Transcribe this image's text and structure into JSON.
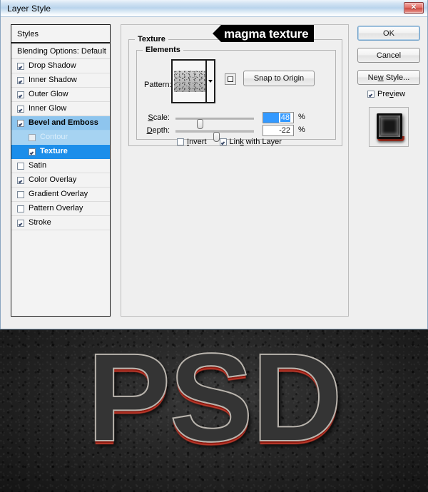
{
  "window": {
    "title": "Layer Style",
    "close_label": "✕",
    "close_icon": "close-icon"
  },
  "styles_panel": {
    "header": "Styles",
    "blending_options": "Blending Options: Default",
    "effects": [
      {
        "label": "Drop Shadow",
        "checked": true,
        "selected": "none",
        "sub": false
      },
      {
        "label": "Inner Shadow",
        "checked": true,
        "selected": "none",
        "sub": false
      },
      {
        "label": "Outer Glow",
        "checked": true,
        "selected": "none",
        "sub": false
      },
      {
        "label": "Inner Glow",
        "checked": true,
        "selected": "none",
        "sub": false
      },
      {
        "label": "Bevel and Emboss",
        "checked": true,
        "selected": "soft",
        "sub": false
      },
      {
        "label": "Contour",
        "checked": false,
        "selected": "softer",
        "sub": true
      },
      {
        "label": "Texture",
        "checked": true,
        "selected": "strong",
        "sub": true
      },
      {
        "label": "Satin",
        "checked": false,
        "selected": "none",
        "sub": false
      },
      {
        "label": "Color Overlay",
        "checked": true,
        "selected": "none",
        "sub": false
      },
      {
        "label": "Gradient Overlay",
        "checked": false,
        "selected": "none",
        "sub": false
      },
      {
        "label": "Pattern Overlay",
        "checked": false,
        "selected": "none",
        "sub": false
      },
      {
        "label": "Stroke",
        "checked": true,
        "selected": "none",
        "sub": false
      }
    ]
  },
  "options_panel": {
    "group_title": "Texture",
    "elements_title": "Elements",
    "pattern_label": "Pattern:",
    "pattern_swatch_name": "magma-texture-swatch",
    "new_preset_tooltip": "Create new preset from this pattern",
    "snap_to_origin_label": "Snap to Origin",
    "scale": {
      "label": "Scale:",
      "value": "48",
      "unit": "%",
      "selected": true,
      "thumb_pct": 30
    },
    "depth": {
      "label": "Depth:",
      "value": "-22",
      "unit": "%",
      "selected": false,
      "thumb_pct": 52
    },
    "invert": {
      "label": "Invert",
      "checked": false
    },
    "link_with_layer": {
      "label": "Link with Layer",
      "checked": true
    }
  },
  "callout": {
    "text": "magma texture"
  },
  "right_column": {
    "ok_label": "OK",
    "cancel_label": "Cancel",
    "new_style_label": "New Style...",
    "preview_label": "Preview",
    "preview_checked": true,
    "thumbnail_name": "style-preview-thumbnail"
  },
  "artwork": {
    "text": "PSD",
    "background": "dark stone texture",
    "text_fill": "#343434",
    "text_stroke": "#b9b4ad",
    "accent_red": "#c0392b"
  }
}
